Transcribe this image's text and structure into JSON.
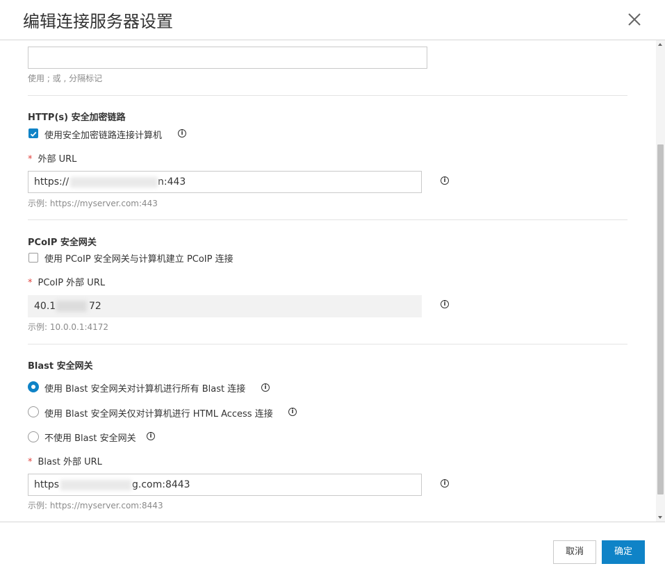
{
  "dialog": {
    "title": "编辑连接服务器设置",
    "close_icon": "close-icon"
  },
  "top_section": {
    "input_value": "",
    "hint": "使用 ; 或 , 分隔标记"
  },
  "https_section": {
    "title": "HTTP(s) 安全加密链路",
    "checkbox_label": "使用安全加密链路连接计算机",
    "checkbox_checked": true,
    "url_label": "外部 URL",
    "url_value_prefix": "https://",
    "url_value_suffix": "n:443",
    "url_hint": "示例: https://myserver.com:443"
  },
  "pcoip_section": {
    "title": "PCoIP 安全网关",
    "checkbox_label": "使用 PCoIP 安全网关与计算机建立 PCoIP 连接",
    "checkbox_checked": false,
    "url_label": "PCoIP 外部 URL",
    "url_value_prefix": "40.1",
    "url_value_suffix": "72",
    "url_hint": "示例: 10.0.0.1:4172"
  },
  "blast_section": {
    "title": "Blast 安全网关",
    "options": [
      {
        "label": "使用 Blast 安全网关对计算机进行所有 Blast 连接",
        "selected": true
      },
      {
        "label": "使用 Blast 安全网关仅对计算机进行 HTML Access 连接",
        "selected": false
      },
      {
        "label": "不使用 Blast 安全网关",
        "selected": false
      }
    ],
    "url_label": "Blast 外部 URL",
    "url_value_prefix": "https",
    "url_value_suffix": "g.com:8443",
    "url_hint": "示例: https://myserver.com:8443"
  },
  "required_mark": "*",
  "info_glyph": "i",
  "footer": {
    "cancel_label": "取消",
    "ok_label": "确定"
  },
  "colors": {
    "accent": "#0f83c7",
    "required": "#e0433e"
  }
}
